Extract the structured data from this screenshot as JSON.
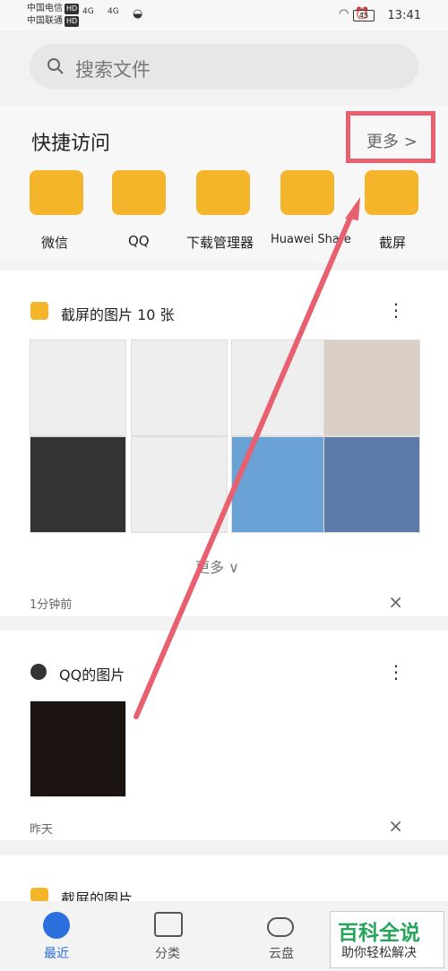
{
  "status": {
    "carrier1": "中国电信",
    "carrier2": "中国联通",
    "hd": "HD",
    "signal1": "4G",
    "signal2": "4G",
    "battery": "45",
    "time": "13:41"
  },
  "search": {
    "placeholder": "搜索文件"
  },
  "quick": {
    "title": "快捷访问",
    "more": "更多 >",
    "items": [
      "微信",
      "QQ",
      "下载管理器",
      "Huawei Share",
      "截屏"
    ]
  },
  "sections": [
    {
      "title": "截屏的图片 10 张",
      "more_label": "更多 ∨",
      "time": "1分钟前"
    },
    {
      "title": "QQ的图片",
      "time": "昨天"
    },
    {
      "title": "截屏的图片"
    }
  ],
  "nav": {
    "items": [
      "最近",
      "分类",
      "云盘"
    ]
  },
  "watermark": {
    "line1": "百科全说",
    "line2": "助你轻松解决"
  },
  "colors": {
    "folder": "#f5b52b",
    "accent": "#2b6fdc",
    "highlight": "#e86070"
  }
}
